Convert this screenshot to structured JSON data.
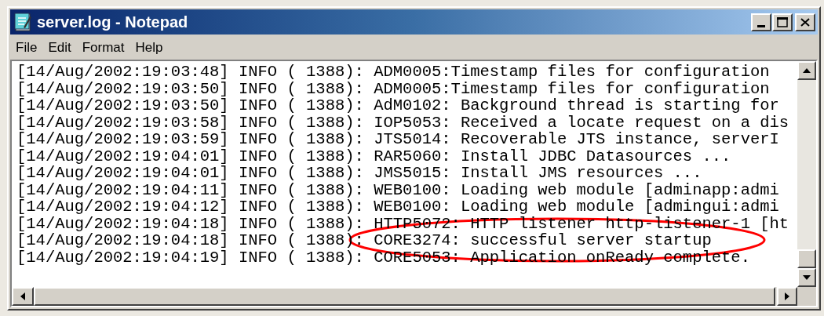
{
  "window": {
    "title": "server.log - Notepad"
  },
  "menu": [
    {
      "label": "File"
    },
    {
      "label": "Edit"
    },
    {
      "label": "Format"
    },
    {
      "label": "Help"
    }
  ],
  "lines": [
    "[14/Aug/2002:19:03:48] INFO ( 1388): ADM0005:Timestamp files for configuration",
    "[14/Aug/2002:19:03:50] INFO ( 1388): ADM0005:Timestamp files for configuration",
    "[14/Aug/2002:19:03:50] INFO ( 1388): AdM0102: Background thread is starting for",
    "[14/Aug/2002:19:03:58] INFO ( 1388): IOP5053: Received a locate request on a dis",
    "[14/Aug/2002:19:03:59] INFO ( 1388): JTS5014: Recoverable JTS instance, serverI",
    "[14/Aug/2002:19:04:01] INFO ( 1388): RAR5060: Install JDBC Datasources ...",
    "[14/Aug/2002:19:04:01] INFO ( 1388): JMS5015: Install JMS resources ...",
    "[14/Aug/2002:19:04:11] INFO ( 1388): WEB0100: Loading web module [adminapp:admi",
    "[14/Aug/2002:19:04:12] INFO ( 1388): WEB0100: Loading web module [admingui:admi",
    "[14/Aug/2002:19:04:18] INFO ( 1388): HTTP5072: HTTP listener http-listener-1 [ht",
    "[14/Aug/2002:19:04:18] INFO ( 1388): CORE3274: successful server startup",
    "[14/Aug/2002:19:04:19] INFO ( 1388): CORE5053: Application onReady complete."
  ]
}
